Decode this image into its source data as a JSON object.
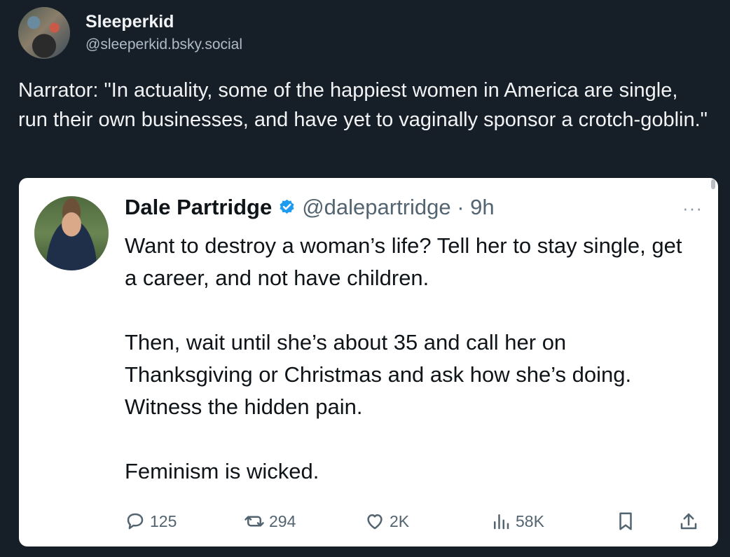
{
  "post": {
    "display_name": "Sleeperkid",
    "handle": "@sleeperkid.bsky.social",
    "text": "Narrator: \"In actuality, some of the happiest women in America are single, run their own businesses, and have yet to vaginally sponsor a crotch-goblin.\""
  },
  "embed": {
    "name": "Dale Partridge",
    "handle_time": "@dalepartridge · 9h",
    "more": "···",
    "paragraphs": [
      "Want to destroy a woman’s life? Tell her to stay single, get a career, and not have children.",
      "Then, wait until she’s about 35 and call her on Thanksgiving or Christmas and ask how she’s doing. Witness the hidden pain.",
      "Feminism is wicked."
    ],
    "stats": {
      "replies": "125",
      "reposts": "294",
      "likes": "2K",
      "views": "58K"
    },
    "colors": {
      "verified": "#1d9bf0",
      "text": "#0f1419",
      "muted": "#536471"
    }
  },
  "colors": {
    "background": "#161e27",
    "handle": "#aebbc9"
  }
}
